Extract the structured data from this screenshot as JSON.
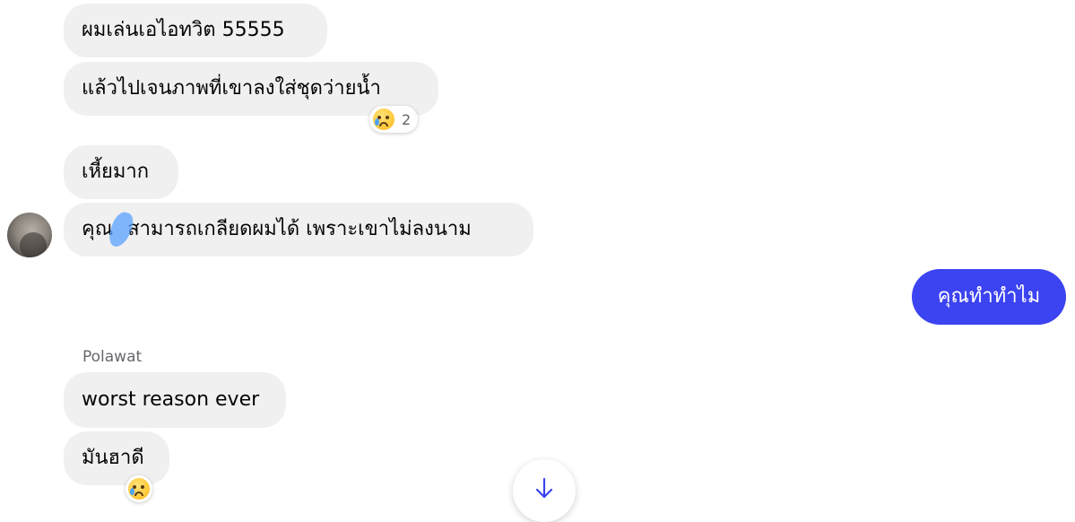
{
  "messages": {
    "m1": "ผมเล่นเอไอทวิต 55555",
    "m2": "แล้วไปเจนภาพที่เขาลงใส่ชุดว่ายน้ำ",
    "m2_reaction_count": "2",
    "m3": "เหี้ยมาก",
    "m4_before": "คุณ",
    "m4_after": "สามารถเกลียดผมได้ เพราะเขาไม่ลงนาม",
    "outgoing": "คุณทำทำไม",
    "sender_name": "Polawat",
    "m5": "worst reason ever",
    "m6": "มันฮาดี"
  },
  "icons": {
    "reaction": "sad-tear-emoji-icon",
    "scroll": "arrow-down-icon",
    "avatar": "contact-avatar"
  },
  "colors": {
    "incoming_bubble": "#f0f0f0",
    "outgoing_bubble": "#3c43f0",
    "scroll_arrow": "#3c43f0"
  }
}
